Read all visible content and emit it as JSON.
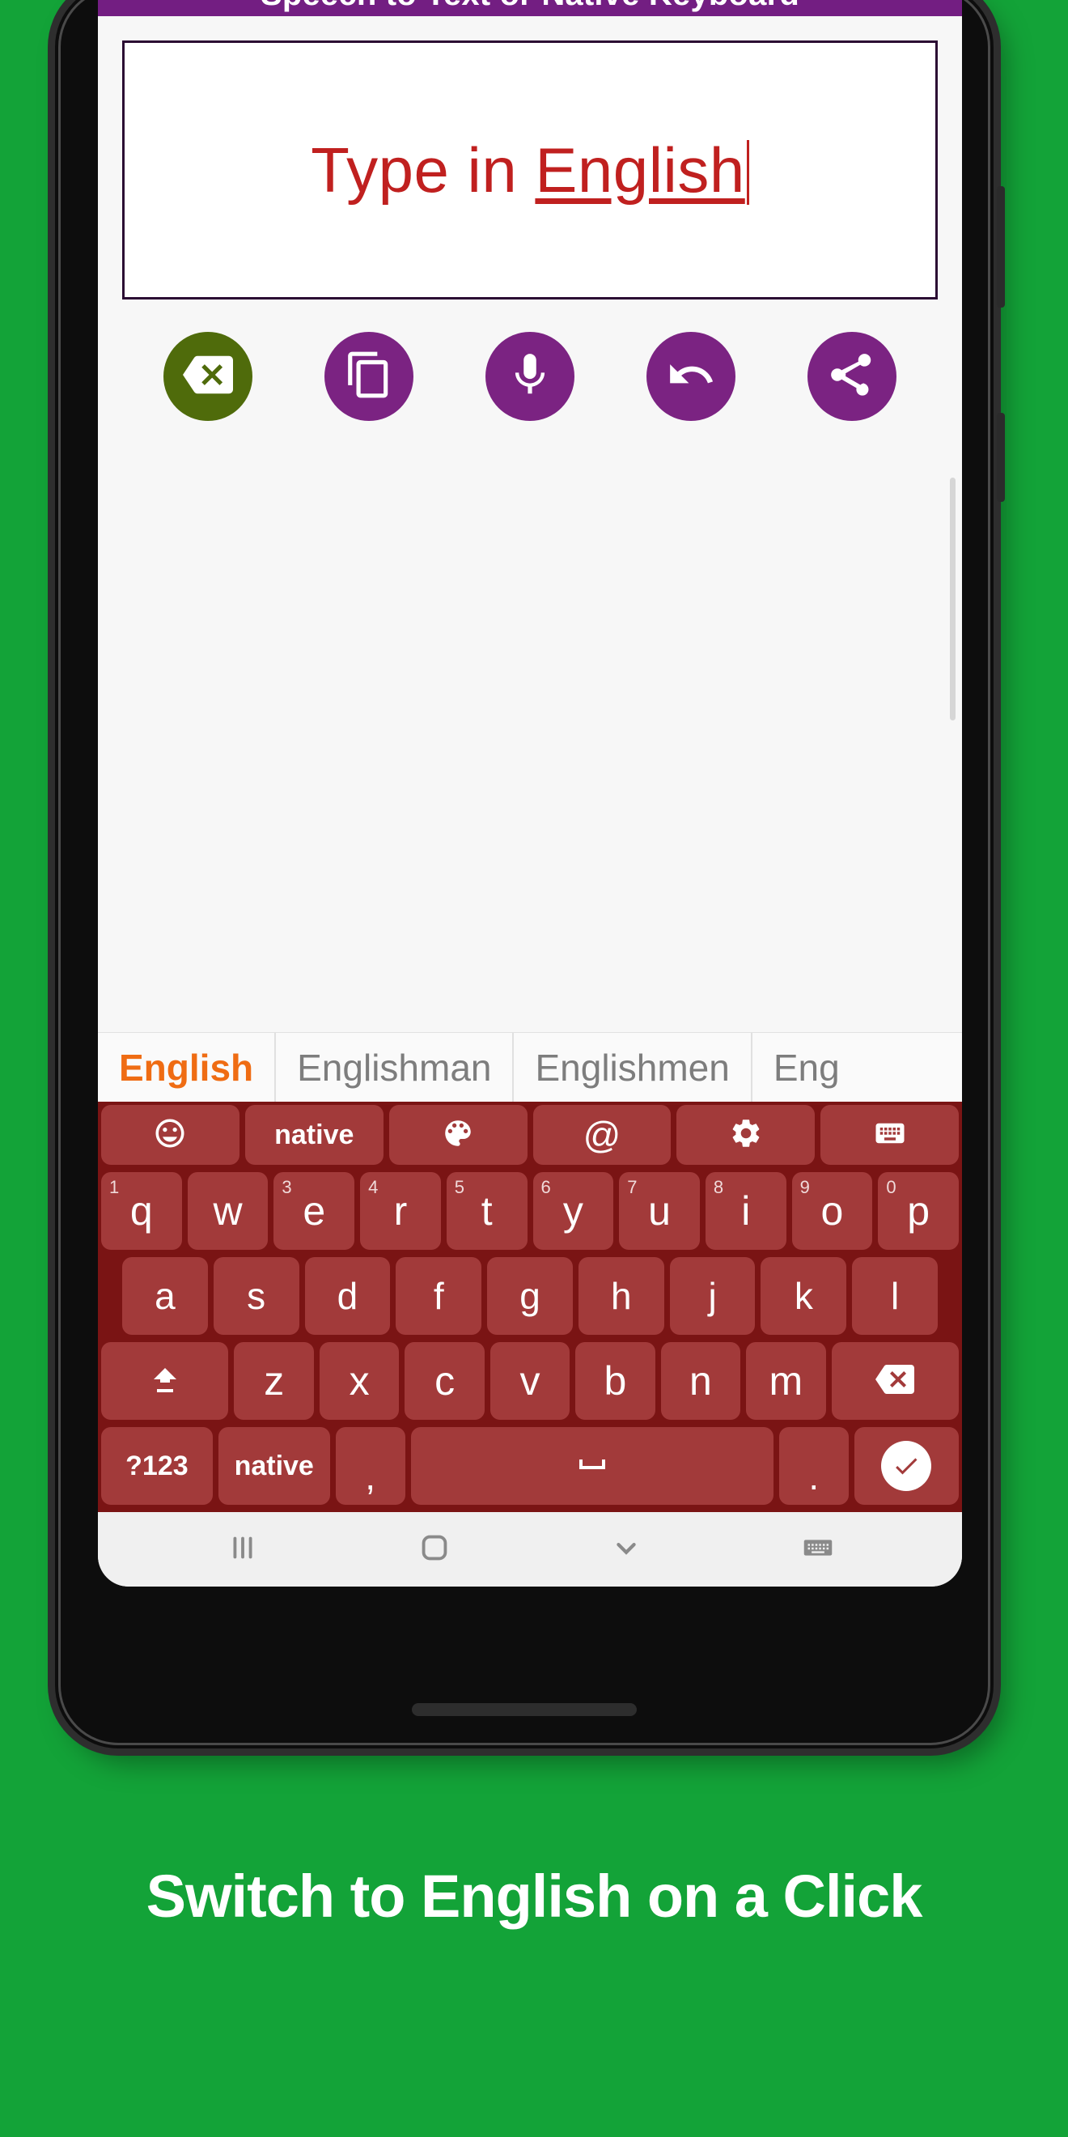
{
  "background_color": "#13a338",
  "caption": "Switch to English on a Click",
  "app": {
    "title": "Speech to Text or Native Keyboard",
    "app_bar_color": "#731e82",
    "text_field": {
      "value_prefix": "Type in ",
      "value_underlined": "English",
      "text_color": "#c0201f",
      "border_color": "#2b0b33"
    },
    "actions": [
      {
        "name": "clear-text",
        "icon": "backspace-icon",
        "color": "#4f6b0b"
      },
      {
        "name": "copy-text",
        "icon": "copy-icon",
        "color": "#7b2382"
      },
      {
        "name": "microphone",
        "icon": "mic-icon",
        "color": "#7b2382"
      },
      {
        "name": "undo",
        "icon": "undo-icon",
        "color": "#7b2382"
      },
      {
        "name": "share",
        "icon": "share-icon",
        "color": "#7b2382"
      }
    ]
  },
  "keyboard": {
    "background": "#7a1414",
    "key_color": "#a23a3a",
    "suggestions": [
      {
        "text": "English",
        "active": true
      },
      {
        "text": "Englishman",
        "active": false
      },
      {
        "text": "Englishmen",
        "active": false
      },
      {
        "text": "Eng",
        "active": false
      }
    ],
    "toolbar": [
      {
        "label": "",
        "icon": "emoji-icon"
      },
      {
        "label": "native",
        "icon": ""
      },
      {
        "label": "",
        "icon": "palette-icon"
      },
      {
        "label": "@",
        "icon": ""
      },
      {
        "label": "",
        "icon": "gear-icon"
      },
      {
        "label": "",
        "icon": "keyboard-icon"
      }
    ],
    "row1": [
      {
        "key": "q",
        "num": "1"
      },
      {
        "key": "w",
        "num": ""
      },
      {
        "key": "e",
        "num": "3"
      },
      {
        "key": "r",
        "num": "4"
      },
      {
        "key": "t",
        "num": "5"
      },
      {
        "key": "y",
        "num": "6"
      },
      {
        "key": "u",
        "num": "7"
      },
      {
        "key": "i",
        "num": "8"
      },
      {
        "key": "o",
        "num": "9"
      },
      {
        "key": "p",
        "num": "0"
      }
    ],
    "row2": [
      "a",
      "s",
      "d",
      "f",
      "g",
      "h",
      "j",
      "k",
      "l"
    ],
    "row3_letters": [
      "z",
      "x",
      "c",
      "v",
      "b",
      "n",
      "m"
    ],
    "row3_shift_icon": "shift-icon",
    "row3_backspace_icon": "backspace-icon",
    "row4": {
      "symbols_label": "?123",
      "lang_label": "native",
      "comma_label": ",",
      "space_icon": "space-icon",
      "period_label": ".",
      "enter_icon": "check-icon"
    }
  },
  "nav_bar": [
    {
      "name": "recents-button",
      "icon": "recents-icon"
    },
    {
      "name": "home-button",
      "icon": "home-icon"
    },
    {
      "name": "back-button",
      "icon": "chevron-down-icon"
    },
    {
      "name": "hide-keyboard-button",
      "icon": "keyboard-icon"
    }
  ]
}
